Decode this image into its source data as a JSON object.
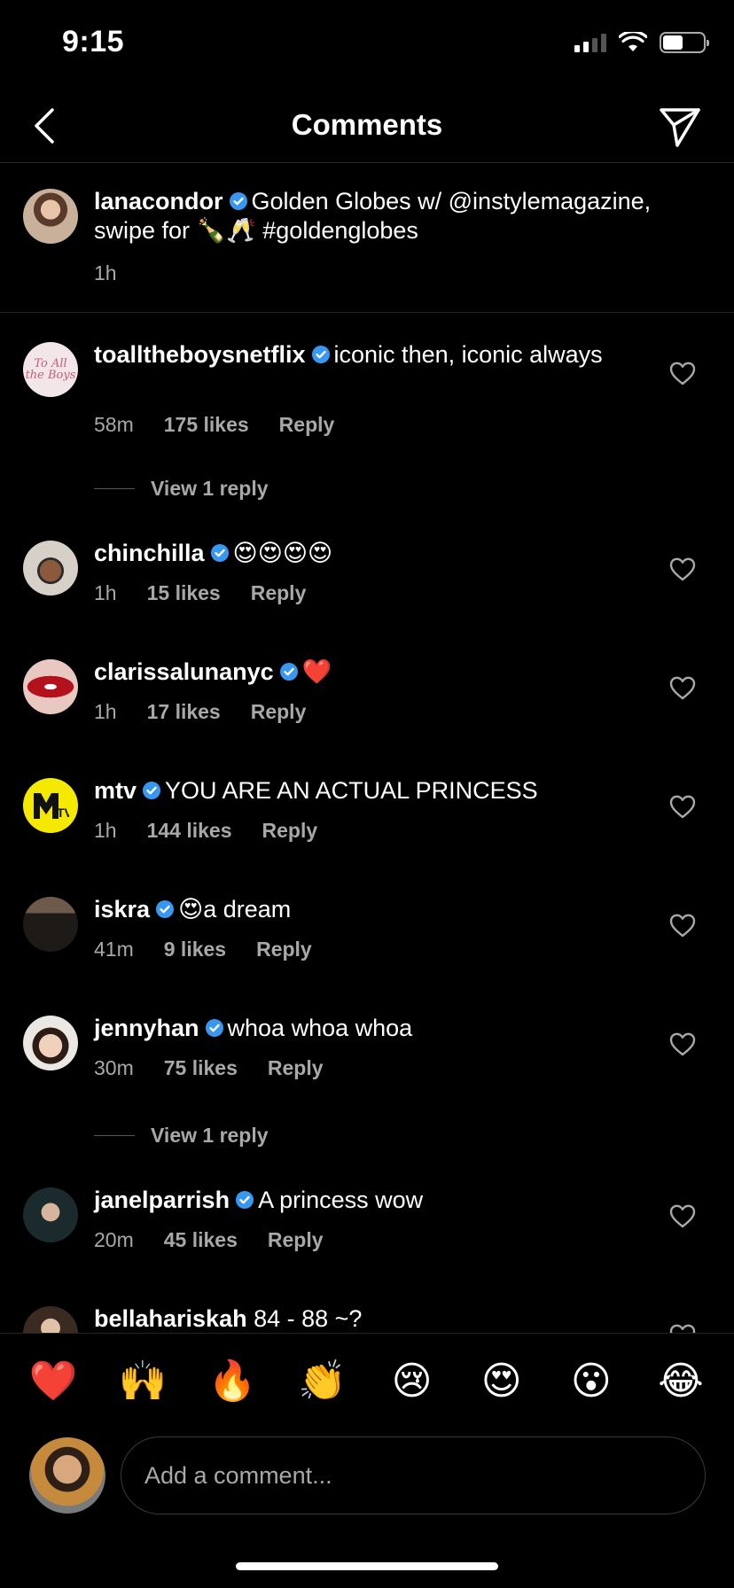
{
  "status_bar": {
    "time": "9:15"
  },
  "header": {
    "title": "Comments"
  },
  "caption": {
    "username": "lanacondor",
    "text": "Golden Globes w/ @instylemagazine, swipe for 🍾🥂 #goldenglobes",
    "time": "1h"
  },
  "comments": [
    {
      "username": "toalltheboysnetflix",
      "text": "iconic then, iconic always",
      "time": "58m",
      "likes": "175 likes",
      "reply": "Reply",
      "view_replies": "View 1 reply"
    },
    {
      "username": "chinchilla",
      "text": "😍😍😍😍",
      "time": "1h",
      "likes": "15 likes",
      "reply": "Reply"
    },
    {
      "username": "clarissalunanyc",
      "text": "❤️",
      "time": "1h",
      "likes": "17 likes",
      "reply": "Reply"
    },
    {
      "username": "mtv",
      "text": "YOU ARE AN ACTUAL PRINCESS",
      "time": "1h",
      "likes": "144 likes",
      "reply": "Reply"
    },
    {
      "username": "iskra",
      "text": "😍a dream",
      "time": "41m",
      "likes": "9 likes",
      "reply": "Reply"
    },
    {
      "username": "jennyhan",
      "text": "whoa whoa whoa",
      "time": "30m",
      "likes": "75 likes",
      "reply": "Reply",
      "view_replies": "View 1 reply"
    },
    {
      "username": "janelparrish",
      "text": "A princess wow",
      "time": "20m",
      "likes": "45 likes",
      "reply": "Reply"
    },
    {
      "username": "bellahariskah",
      "text": "84 - 88 ~?"
    }
  ],
  "emoji_bar": [
    "❤️",
    "🙌",
    "🔥",
    "👏",
    "😢",
    "😍",
    "😮",
    "😂"
  ],
  "composer": {
    "placeholder": "Add a comment..."
  },
  "colors": {
    "background": "#000000",
    "secondary_text": "#a8a8a8",
    "verified": "#3897f0",
    "divider": "#262626"
  },
  "icons": [
    "back-chevron-icon",
    "direct-share-icon",
    "verified-badge-icon",
    "heart-outline-icon"
  ]
}
